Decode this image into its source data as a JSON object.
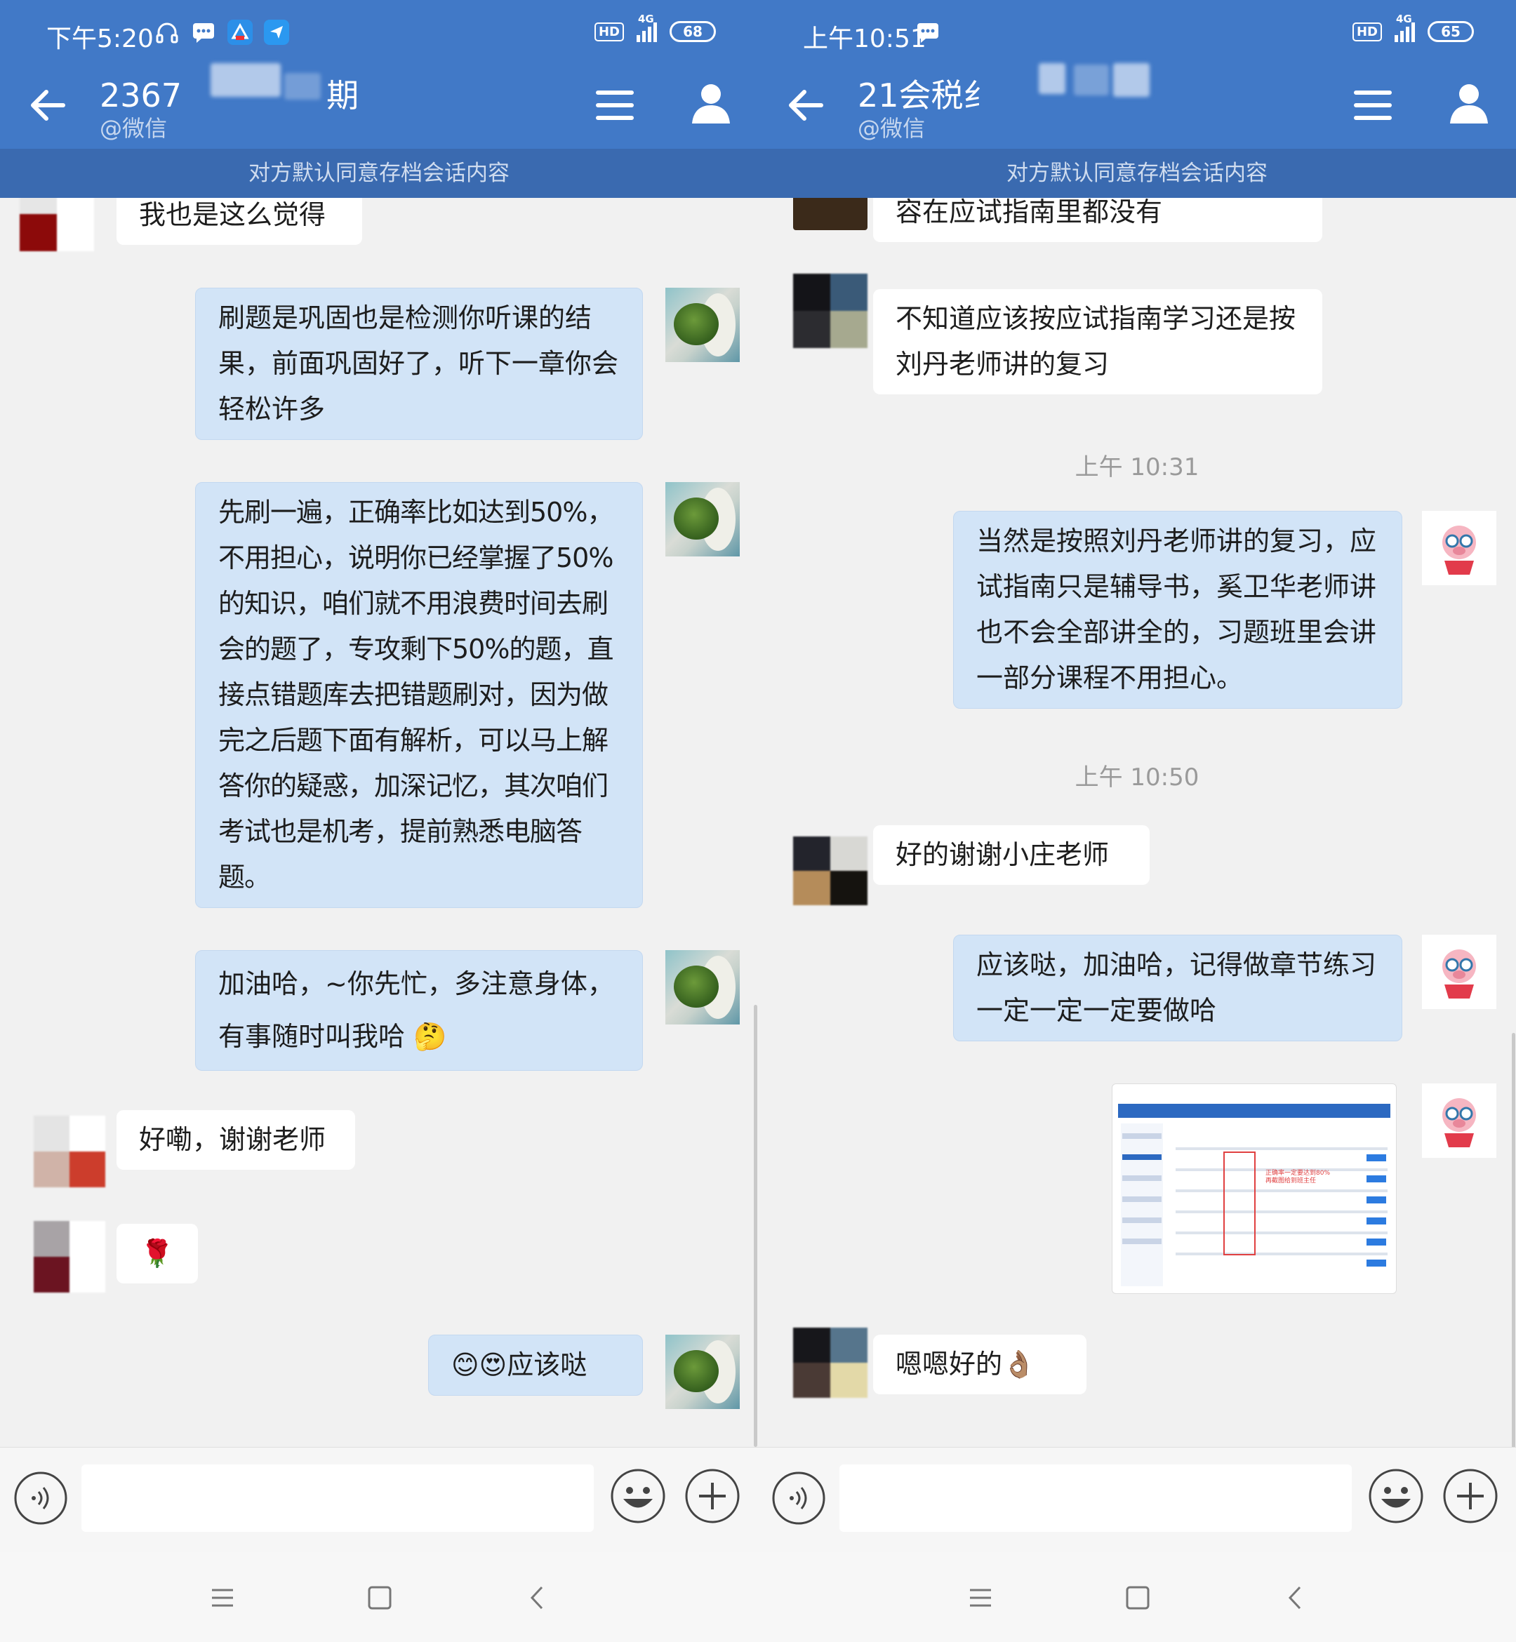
{
  "left": {
    "status": {
      "time": "下午5:20",
      "network": "4G",
      "battery": "68",
      "hd": "HD"
    },
    "nav": {
      "title_prefix": "2367",
      "title_suffix": "期",
      "subtitle": "@微信"
    },
    "notice": "对方默认同意存档会话内容",
    "messages": {
      "m1": "我也是这么觉得",
      "m2": "刷题是巩固也是检测你听课的结果，前面巩固好了，听下一章你会轻松许多",
      "m3": "先刷一遍，正确率比如达到50%，不用担心，说明你已经掌握了50%的知识，咱们就不用浪费时间去刷会的题了，专攻剩下50%的题，直接点错题库去把错题刷对，因为做完之后题下面有解析，可以马上解答你的疑惑，加深记忆，其次咱们考试也是机考，提前熟悉电脑答题。",
      "m4": "加油哈，~你先忙，多注意身体，有事随时叫我哈",
      "m4_emoji": "🤔",
      "m5": "好嘞，谢谢老师",
      "m6": "🌹",
      "m7_emoji": "😊😍",
      "m7": "应该哒"
    }
  },
  "right": {
    "status": {
      "time": "上午10:51",
      "network": "4G",
      "battery": "65",
      "hd": "HD"
    },
    "nav": {
      "title_prefix": "21会税纟",
      "subtitle": "@微信"
    },
    "notice": "对方默认同意存档会话内容",
    "messages": {
      "m1": "容在应试指南里都没有",
      "m2": "不知道应该按应试指南学习还是按刘丹老师讲的复习",
      "ts1": "上午 10:31",
      "m3": "当然是按照刘丹老师讲的复习，应试指南只是辅导书，奚卫华老师讲也不会全部讲全的，习题班里会讲一部分课程不用担心。",
      "ts2": "上午 10:50",
      "m4": "好的谢谢小庄老师",
      "m5": "应该哒，加油哈，记得做章节练习一定一定一定要做哈",
      "screenshot_note": "正确率一定要达到80%\n再截图给到班主任",
      "m6": "嗯嗯好的",
      "m6_emoji": "👌🏽"
    }
  },
  "icons": [
    "back-arrow-icon",
    "menu-icon",
    "user-icon",
    "voice-icon",
    "emoji-icon",
    "plus-icon",
    "nav-menu-icon",
    "nav-home-icon",
    "nav-back-icon"
  ],
  "colors": {
    "header": "#4179c7",
    "notice_bar": "#3a6ab0",
    "outgoing_bubble": "#d2e4f7",
    "incoming_bubble": "#ffffff",
    "background": "#f1f1f1"
  }
}
